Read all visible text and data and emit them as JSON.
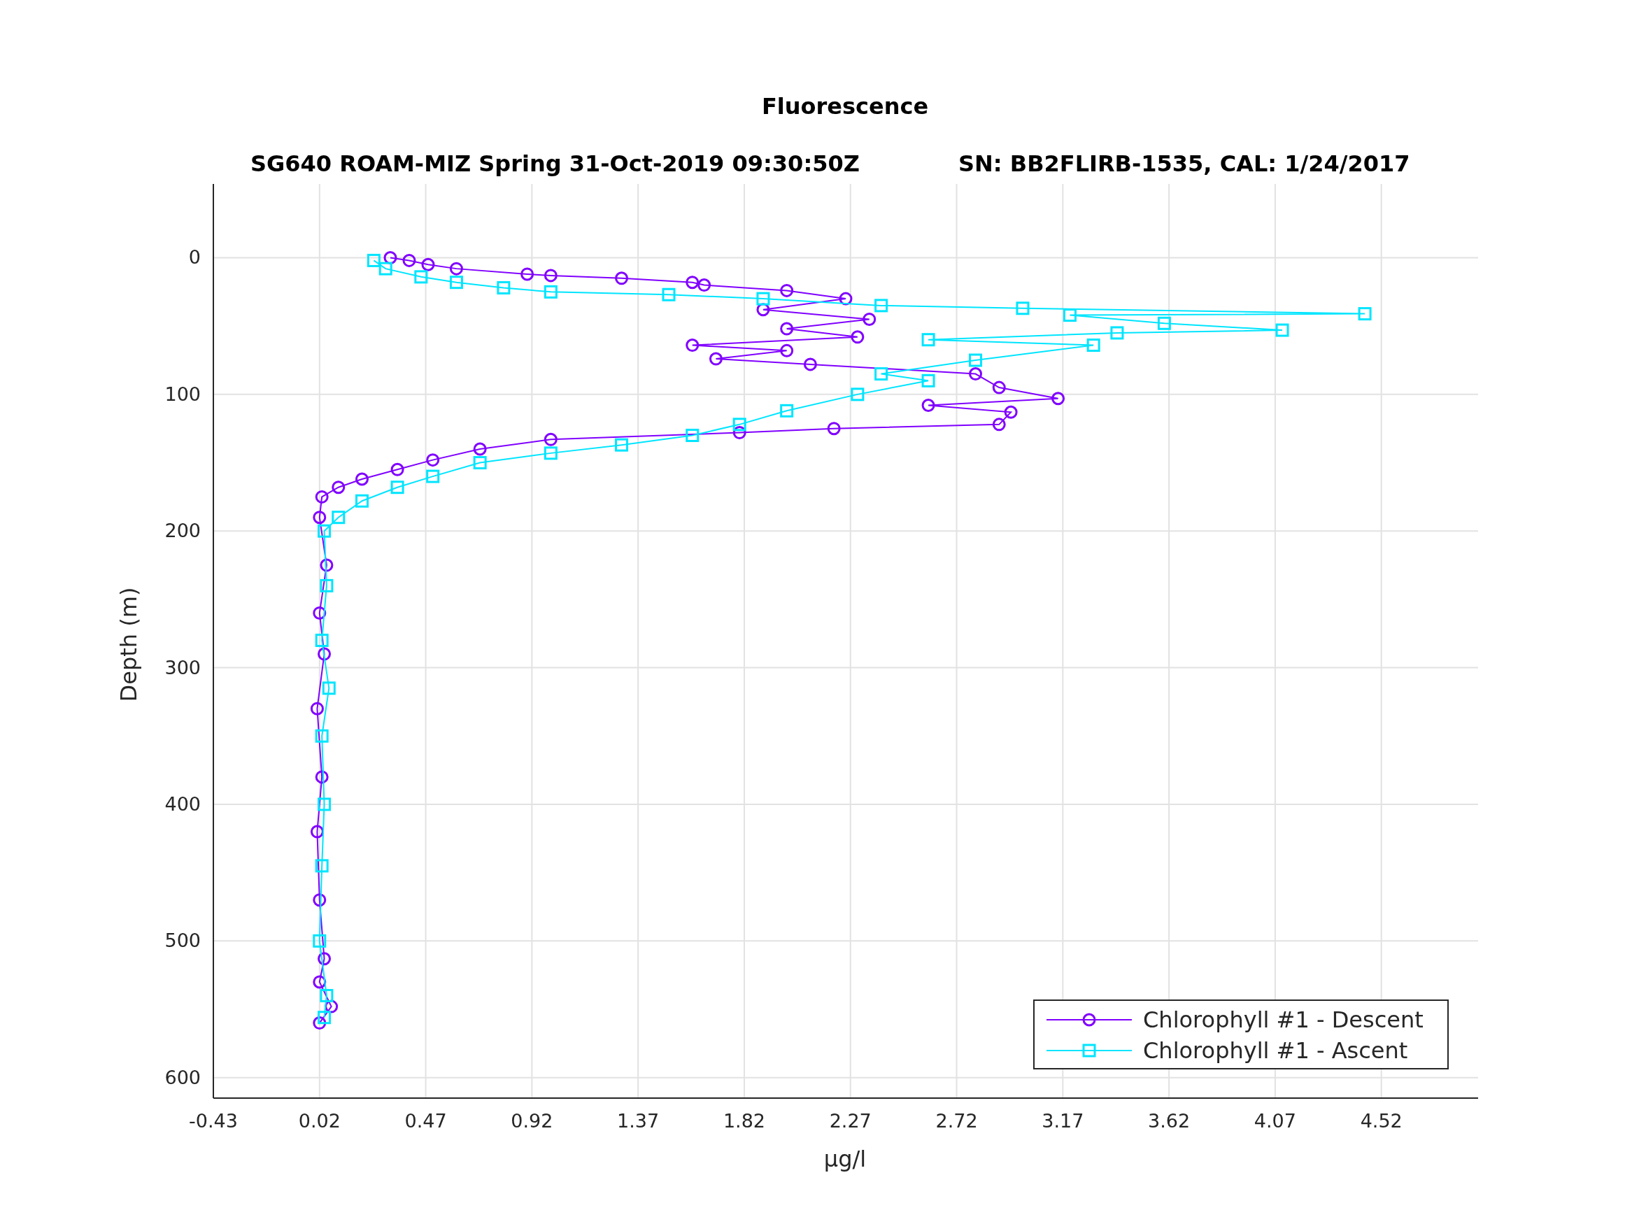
{
  "figure": {
    "title": "Fluorescence",
    "subtitle_left": "SG640 ROAM-MIZ Spring 31-Oct-2019 09:30:50Z",
    "subtitle_right": "SN: BB2FLIRB-1535, CAL: 1/24/2017",
    "chart_data": {
      "type": "line",
      "xlabel": "μg/l",
      "ylabel": "Depth (m)",
      "xlim": [
        -0.43,
        4.93
      ],
      "xticks": [
        -0.43,
        0.02,
        0.47,
        0.92,
        1.37,
        1.82,
        2.27,
        2.72,
        3.17,
        3.62,
        4.07,
        4.52
      ],
      "ylim": [
        615,
        -54
      ],
      "yticks": [
        0,
        100,
        200,
        300,
        400,
        500,
        600
      ],
      "grid": true,
      "legend": true,
      "series": [
        {
          "name": "Chlorophyll #1 - Descent",
          "color": "#8000ff",
          "marker": "circle",
          "x": [
            0.32,
            0.4,
            0.48,
            0.6,
            0.9,
            1.0,
            1.3,
            1.6,
            1.65,
            2.0,
            2.25,
            1.9,
            2.35,
            2.0,
            2.3,
            1.6,
            2.0,
            1.7,
            2.1,
            2.8,
            2.9,
            3.15,
            2.6,
            2.95,
            2.9,
            2.2,
            1.8,
            1.0,
            0.7,
            0.5,
            0.35,
            0.2,
            0.1,
            0.03,
            0.02,
            0.05,
            0.02,
            0.04,
            0.01,
            0.03,
            0.01,
            0.02,
            0.04,
            0.02,
            0.07,
            0.02
          ],
          "values": [
            0,
            2,
            5,
            8,
            12,
            13,
            15,
            18,
            20,
            24,
            30,
            38,
            45,
            52,
            58,
            64,
            68,
            74,
            78,
            85,
            95,
            103,
            108,
            113,
            122,
            125,
            128,
            133,
            140,
            148,
            155,
            162,
            168,
            175,
            190,
            225,
            260,
            290,
            330,
            380,
            420,
            470,
            513,
            530,
            548,
            560
          ]
        },
        {
          "name": "Chlorophyll #1 - Ascent",
          "color": "#00e5ff",
          "marker": "square",
          "x": [
            0.04,
            0.05,
            0.02,
            0.03,
            0.04,
            0.03,
            0.06,
            0.03,
            0.05,
            0.04,
            0.1,
            0.2,
            0.35,
            0.5,
            0.7,
            1.0,
            1.3,
            1.6,
            1.8,
            2.0,
            2.3,
            2.6,
            2.4,
            2.8,
            3.3,
            2.6,
            3.4,
            4.1,
            3.6,
            3.2,
            4.45,
            3.0,
            2.4,
            1.9,
            1.5,
            1.0,
            0.8,
            0.6,
            0.45,
            0.3,
            0.25
          ],
          "values": [
            556,
            540,
            500,
            445,
            400,
            350,
            315,
            280,
            240,
            200,
            190,
            178,
            168,
            160,
            150,
            143,
            137,
            130,
            122,
            112,
            100,
            90,
            85,
            75,
            64,
            60,
            55,
            53,
            48,
            42,
            41,
            37,
            35,
            30,
            27,
            25,
            22,
            18,
            14,
            8,
            2
          ]
        }
      ]
    }
  }
}
